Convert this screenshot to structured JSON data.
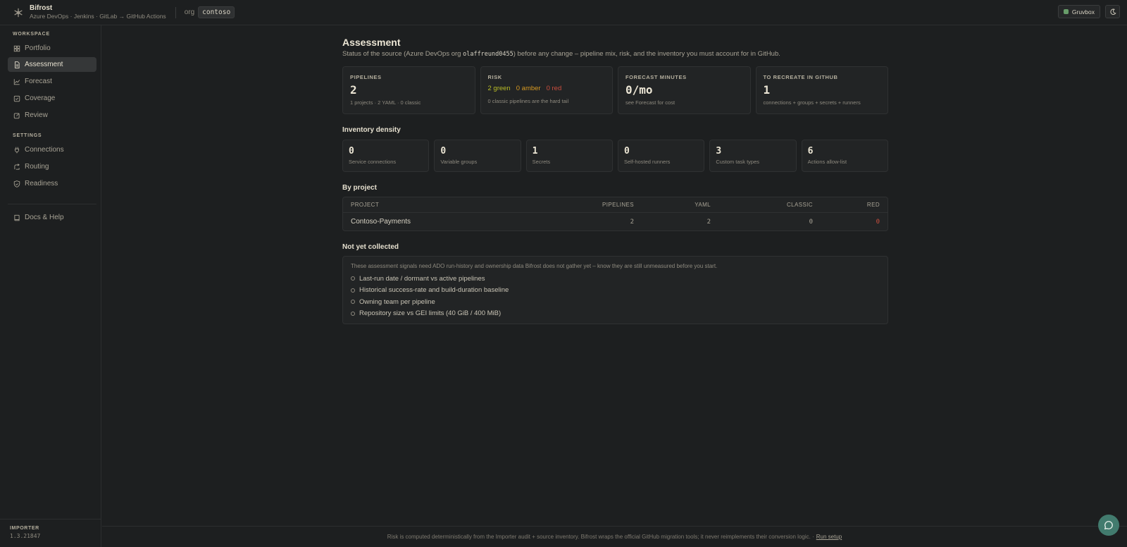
{
  "app": {
    "name": "Bifrost",
    "subtitle": "Azure DevOps · Jenkins · GitLab → GitHub Actions",
    "org_label": "org",
    "org_value": "contoso",
    "theme_label": "Gruvbox"
  },
  "sidebar": {
    "workspace_label": "WORKSPACE",
    "workspace_items": [
      {
        "label": "Portfolio",
        "icon": "grid-icon"
      },
      {
        "label": "Assessment",
        "icon": "document-icon",
        "active": true
      },
      {
        "label": "Forecast",
        "icon": "chart-line-icon"
      },
      {
        "label": "Coverage",
        "icon": "check-square-icon"
      },
      {
        "label": "Review",
        "icon": "edit-square-icon"
      }
    ],
    "settings_label": "SETTINGS",
    "settings_items": [
      {
        "label": "Connections",
        "icon": "plug-icon"
      },
      {
        "label": "Routing",
        "icon": "route-icon"
      },
      {
        "label": "Readiness",
        "icon": "shield-icon"
      }
    ],
    "docs_label": "Docs & Help",
    "importer_label": "IMPORTER",
    "importer_version": "1.3.21847"
  },
  "page": {
    "title": "Assessment",
    "subtitle_before": "Status of the source (Azure DevOps org ",
    "subtitle_org": "olaffreund0455",
    "subtitle_after": ") before any change – pipeline mix, risk, and the inventory you must account for in GitHub."
  },
  "stats": {
    "pipelines": {
      "label": "PIPELINES",
      "value": "2",
      "note": "1 projects · 2 YAML · 0 classic"
    },
    "risk": {
      "label": "RISK",
      "green": "2 green",
      "amber": "0 amber",
      "red": "0 red",
      "note": "0 classic pipelines are the hard tail"
    },
    "forecast": {
      "label": "FORECAST MINUTES",
      "value": "0/mo",
      "note": "see Forecast for cost"
    },
    "recreate": {
      "label": "TO RECREATE IN GITHUB",
      "value": "1",
      "note": "connections + groups + secrets + runners"
    }
  },
  "density": {
    "title": "Inventory density",
    "items": [
      {
        "value": "0",
        "label": "Service connections"
      },
      {
        "value": "0",
        "label": "Variable groups"
      },
      {
        "value": "1",
        "label": "Secrets"
      },
      {
        "value": "0",
        "label": "Self-hosted runners"
      },
      {
        "value": "3",
        "label": "Custom task types"
      },
      {
        "value": "6",
        "label": "Actions allow-list"
      }
    ]
  },
  "by_project": {
    "title": "By project",
    "headers": {
      "project": "PROJECT",
      "pipelines": "PIPELINES",
      "yaml": "YAML",
      "classic": "CLASSIC",
      "red": "RED"
    },
    "rows": [
      {
        "project": "Contoso-Payments",
        "pipelines": "2",
        "yaml": "2",
        "classic": "0",
        "red": "0"
      }
    ]
  },
  "not_collected": {
    "title": "Not yet collected",
    "intro": "These assessment signals need ADO run-history and ownership data Bifrost does not gather yet – know they are still unmeasured before you start.",
    "items": [
      "Last-run date / dormant vs active pipelines",
      "Historical success-rate and build-duration baseline",
      "Owning team per pipeline",
      "Repository size vs GEI limits (40 GiB / 400 MiB)"
    ]
  },
  "footer": {
    "text": "Risk is computed deterministically from the Importer audit + source inventory. Bifrost wraps the official GitHub migration tools; it never reimplements their conversion logic. ·",
    "link": "Run setup"
  },
  "colors": {
    "accent": "#689d6a",
    "green": "#b8bb26",
    "amber": "#d79921",
    "red": "#cc4e3e",
    "chat": "#427b6e"
  }
}
